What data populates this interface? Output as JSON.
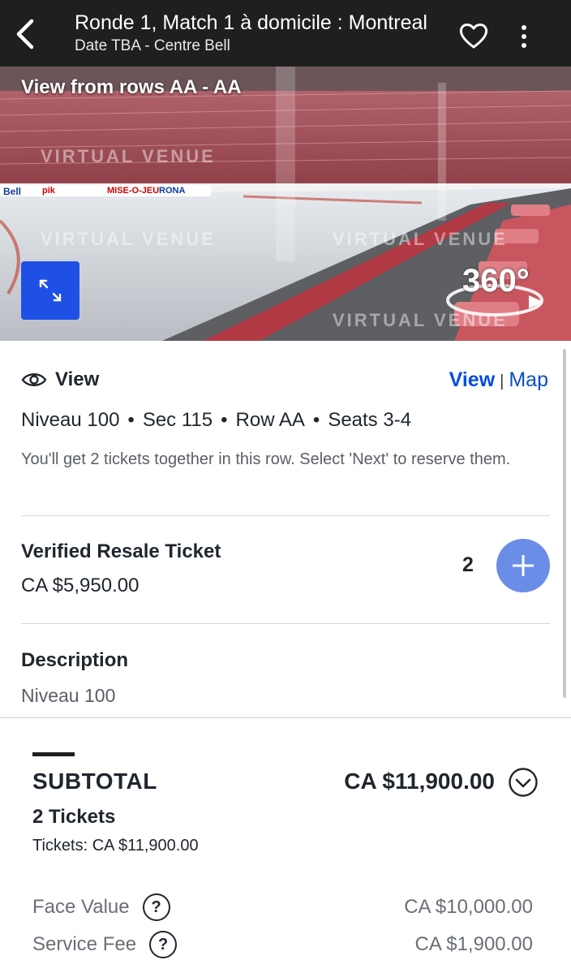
{
  "header": {
    "title": "Ronde 1, Match 1 à domicile : Montreal",
    "subtitle": "Date TBA - Centre Bell",
    "back_icon": "chevron-left-icon",
    "favorite_icon": "heart-icon",
    "more_icon": "vertical-dots-icon"
  },
  "venue_view": {
    "caption": "View from rows AA - AA",
    "watermark": "VIRTUAL VENUE",
    "expand_icon": "expand-arrows-icon",
    "badge_text": "360°",
    "board_ads": [
      "Bell",
      "pik",
      "MISE-O-JEU",
      "RONA"
    ]
  },
  "details": {
    "view_label": "View",
    "toggle": {
      "view": "View",
      "separator": "|",
      "map": "Map"
    },
    "level": "Niveau 100",
    "section": "Sec 115",
    "row": "Row AA",
    "seats": "Seats 3-4",
    "bullet": "•",
    "note": "You'll get 2 tickets together in this row. Select 'Next' to reserve them.",
    "ticket_type": "Verified Resale Ticket",
    "ticket_price": "CA $5,950.00",
    "quantity": "2",
    "description_title": "Description",
    "description_text": "Niveau 100"
  },
  "summary": {
    "subtotal_label": "SUBTOTAL",
    "subtotal_amount": "CA $11,900.00",
    "tickets_count": "2 Tickets",
    "tickets_line": "Tickets: CA $11,900.00",
    "face_value_label": "Face Value",
    "face_value_amount": "CA $10,000.00",
    "service_fee_label": "Service Fee",
    "service_fee_amount": "CA $1,900.00",
    "help_glyph": "?"
  },
  "colors": {
    "header_bg": "#1f1f1f",
    "link_blue": "#024ddf",
    "plus_button": "#6a8de8",
    "expand_button": "#1f50e6"
  }
}
